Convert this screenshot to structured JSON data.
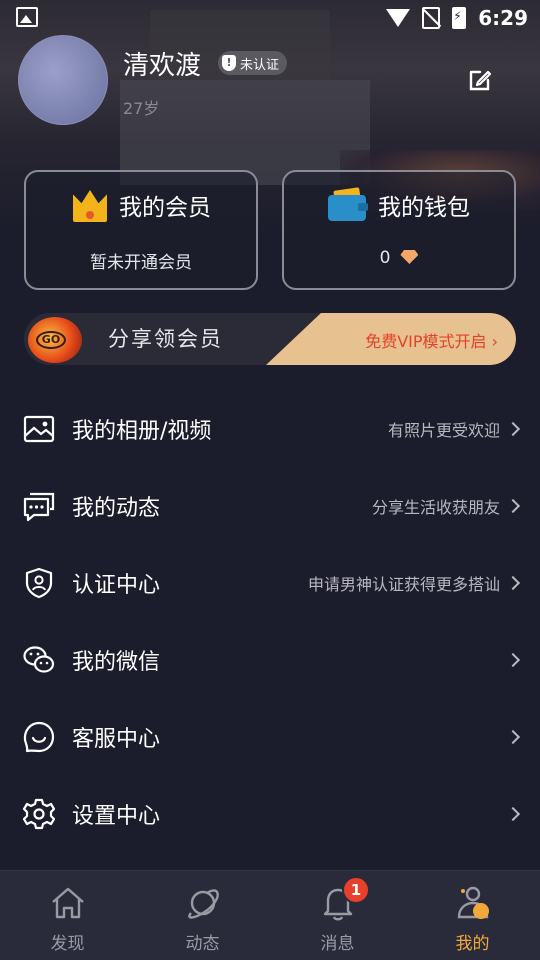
{
  "status_bar": {
    "time": "6:29"
  },
  "profile": {
    "name": "清欢渡",
    "verify_badge": "未认证",
    "age": "27岁"
  },
  "cards": {
    "vip": {
      "title": "我的会员",
      "status": "暂未开通会员"
    },
    "wallet": {
      "title": "我的钱包",
      "balance": "0"
    }
  },
  "banner": {
    "title": "分享领会员",
    "cta": "免费VIP模式开启",
    "badge": "GO"
  },
  "menu": [
    {
      "label": "我的相册/视频",
      "hint": "有照片更受欢迎",
      "icon": "photo-icon"
    },
    {
      "label": "我的动态",
      "hint": "分享生活收获朋友",
      "icon": "chat-dots-icon"
    },
    {
      "label": "认证中心",
      "hint": "申请男神认证获得更多搭讪",
      "icon": "shield-user-icon"
    },
    {
      "label": "我的微信",
      "hint": "",
      "icon": "wechat-icon"
    },
    {
      "label": "客服中心",
      "hint": "",
      "icon": "smile-bubble-icon"
    },
    {
      "label": "设置中心",
      "hint": "",
      "icon": "gear-icon"
    }
  ],
  "tabs": [
    {
      "label": "发现",
      "icon": "house-icon"
    },
    {
      "label": "动态",
      "icon": "planet-icon"
    },
    {
      "label": "消息",
      "icon": "bell-icon",
      "badge": "1"
    },
    {
      "label": "我的",
      "icon": "user-icon",
      "active": true
    }
  ],
  "colors": {
    "accent": "#f3a83a",
    "background": "#1c1d2c",
    "badge_red": "#e8402a",
    "banner_gold": "#e7c18f"
  }
}
